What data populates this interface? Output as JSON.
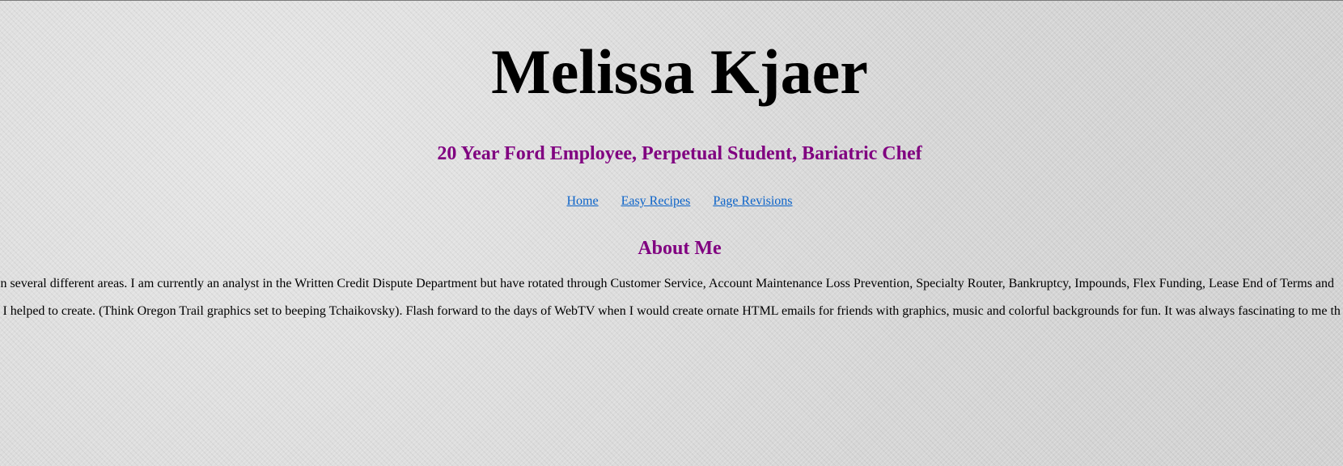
{
  "header": {
    "title": "Melissa Kjaer",
    "tagline": "20 Year Ford Employee, Perpetual Student, Bariatric Chef"
  },
  "nav": {
    "items": [
      {
        "label": "Home"
      },
      {
        "label": "Easy Recipes"
      },
      {
        "label": "Page Revisions"
      }
    ]
  },
  "about": {
    "heading": "About Me",
    "paragraphs": [
      "in several different areas. I am currently an analyst in the Written Credit Dispute Department but have rotated through Customer Service, Account Maintenance Loss Prevention, Specialty Router, Bankruptcy, Impounds, Flex Funding, Lease End of Terms and",
      "t I helped to create. (Think Oregon Trail graphics set to beeping Tchaikovsky). Flash forward to the days of WebTV when I would create ornate HTML emails for friends with graphics, music and colorful backgrounds for fun. It was always fascinating to me th"
    ]
  },
  "colors": {
    "heading_purple": "#800080",
    "link_blue": "#0b63c9",
    "background_gray": "#dcdcdc"
  }
}
